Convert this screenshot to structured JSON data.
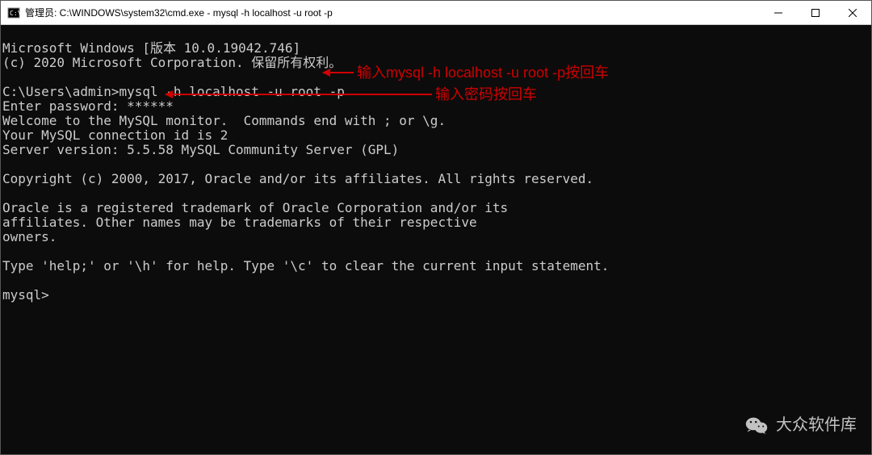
{
  "window": {
    "title": "管理员: C:\\WINDOWS\\system32\\cmd.exe - mysql  -h localhost -u root -p"
  },
  "terminal": {
    "line1": "Microsoft Windows [版本 10.0.19042.746]",
    "line2": "(c) 2020 Microsoft Corporation. 保留所有权利。",
    "line3": "",
    "line4": "C:\\Users\\admin>mysql -h localhost -u root -p",
    "line5": "Enter password: ******",
    "line6": "Welcome to the MySQL monitor.  Commands end with ; or \\g.",
    "line7": "Your MySQL connection id is 2",
    "line8": "Server version: 5.5.58 MySQL Community Server (GPL)",
    "line9": "",
    "line10": "Copyright (c) 2000, 2017, Oracle and/or its affiliates. All rights reserved.",
    "line11": "",
    "line12": "Oracle is a registered trademark of Oracle Corporation and/or its",
    "line13": "affiliates. Other names may be trademarks of their respective",
    "line14": "owners.",
    "line15": "",
    "line16": "Type 'help;' or '\\h' for help. Type '\\c' to clear the current input statement.",
    "line17": "",
    "line18": "mysql>"
  },
  "annotations": {
    "a1": "输入mysql -h localhost -u root -p按回车",
    "a2": "输入密码按回车"
  },
  "watermark": {
    "text": "大众软件库"
  }
}
